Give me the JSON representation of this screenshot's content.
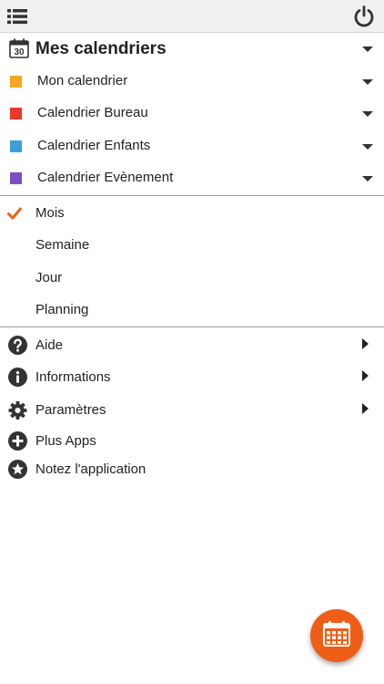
{
  "header": {
    "menu_icon": "list-menu-icon",
    "power_icon": "power-icon"
  },
  "calendars": {
    "title": "Mes calendriers",
    "title_icon": "calendar-30-icon",
    "title_icon_text": "30",
    "items": [
      {
        "label": "Mon calendrier",
        "color": "#f5a623"
      },
      {
        "label": "Calendrier Bureau",
        "color": "#e8392c"
      },
      {
        "label": "Calendrier Enfants",
        "color": "#3aa0dc"
      },
      {
        "label": "Calendrier Evènement",
        "color": "#7b4fc4"
      }
    ]
  },
  "views": {
    "selected": "Mois",
    "items": [
      {
        "label": "Mois"
      },
      {
        "label": "Semaine"
      },
      {
        "label": "Jour"
      },
      {
        "label": "Planning"
      }
    ]
  },
  "more": {
    "items": [
      {
        "label": "Aide",
        "icon": "help-icon"
      },
      {
        "label": "Informations",
        "icon": "info-icon"
      },
      {
        "label": "Paramètres",
        "icon": "gear-icon"
      },
      {
        "label": "Plus Apps",
        "icon": "plus-circle-icon"
      },
      {
        "label": "Notez l'application",
        "icon": "star-circle-icon"
      }
    ]
  },
  "fab": {
    "icon": "calendar-grid-icon"
  },
  "colors": {
    "accent": "#ef5e17",
    "check": "#ef5e17"
  }
}
